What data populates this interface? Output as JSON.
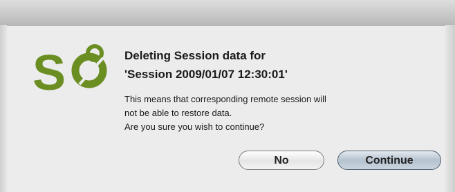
{
  "dialog": {
    "logo_text": "Se",
    "logo_color": "#6b8e23",
    "title_line1": "Deleting Session data for",
    "title_line2": "'Session 2009/01/07 12:30:01'",
    "message_line1": "This means that corresponding remote session will",
    "message_line2": "not be able to restore data.",
    "message_line3": "Are you sure you wish to continue?",
    "buttons": {
      "no_label": "No",
      "continue_label": "Continue"
    }
  }
}
